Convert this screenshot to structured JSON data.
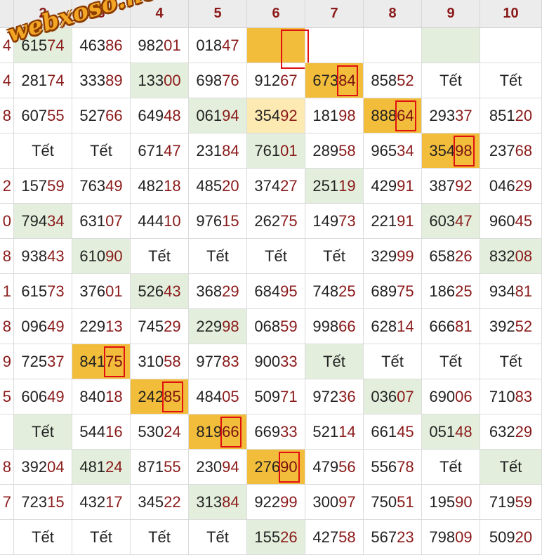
{
  "table": {
    "column_headers": [
      "2",
      "3",
      "4",
      "5",
      "6",
      "7",
      "8",
      "9",
      "10"
    ],
    "left_edge_digits": [
      "4",
      "4",
      "8",
      "",
      "2",
      "0",
      "8",
      "1",
      "8",
      "9",
      "5",
      "",
      "8",
      "7",
      ""
    ],
    "rows": [
      [
        {
          "v": "61574",
          "h": "g"
        },
        {
          "v": "46386"
        },
        {
          "v": "98201"
        },
        {
          "v": "01847"
        },
        {
          "v": "",
          "h": "o",
          "m": 1
        },
        {
          "v": ""
        },
        {
          "v": ""
        },
        {
          "v": "",
          "h": "g"
        },
        {
          "v": ""
        }
      ],
      [
        {
          "v": "28174"
        },
        {
          "v": "33389"
        },
        {
          "v": "13300",
          "h": "g"
        },
        {
          "v": "69876"
        },
        {
          "v": "91267"
        },
        {
          "v": "67384",
          "h": "o",
          "m": 1
        },
        {
          "v": "85852"
        },
        {
          "v": "Tết"
        },
        {
          "v": "Tết"
        }
      ],
      [
        {
          "v": "60755"
        },
        {
          "v": "52766"
        },
        {
          "v": "64948"
        },
        {
          "v": "06194",
          "h": "g"
        },
        {
          "v": "35492",
          "h": "l"
        },
        {
          "v": "18198"
        },
        {
          "v": "88864",
          "h": "o",
          "m": 1
        },
        {
          "v": "29337"
        },
        {
          "v": "85120"
        }
      ],
      [
        {
          "v": "Tết"
        },
        {
          "v": "Tết"
        },
        {
          "v": "67147"
        },
        {
          "v": "23184"
        },
        {
          "v": "76101",
          "h": "g"
        },
        {
          "v": "28958"
        },
        {
          "v": "96534"
        },
        {
          "v": "35498",
          "h": "o",
          "m": 1
        },
        {
          "v": "23768"
        }
      ],
      [
        {
          "v": "15759"
        },
        {
          "v": "76349"
        },
        {
          "v": "48218"
        },
        {
          "v": "48520"
        },
        {
          "v": "37427"
        },
        {
          "v": "25119",
          "h": "g"
        },
        {
          "v": "42991"
        },
        {
          "v": "38792"
        },
        {
          "v": "04629"
        }
      ],
      [
        {
          "v": "79434",
          "h": "g"
        },
        {
          "v": "63107"
        },
        {
          "v": "44410"
        },
        {
          "v": "97615"
        },
        {
          "v": "26275"
        },
        {
          "v": "14973"
        },
        {
          "v": "22191"
        },
        {
          "v": "60347",
          "h": "g"
        },
        {
          "v": "96045"
        }
      ],
      [
        {
          "v": "93843"
        },
        {
          "v": "61090",
          "h": "g"
        },
        {
          "v": "Tết"
        },
        {
          "v": "Tết"
        },
        {
          "v": "Tết"
        },
        {
          "v": "Tết"
        },
        {
          "v": "32999"
        },
        {
          "v": "65826"
        },
        {
          "v": "83208",
          "h": "g"
        }
      ],
      [
        {
          "v": "61573"
        },
        {
          "v": "37601"
        },
        {
          "v": "52643",
          "h": "g"
        },
        {
          "v": "36829"
        },
        {
          "v": "68495"
        },
        {
          "v": "74825"
        },
        {
          "v": "68975"
        },
        {
          "v": "18625"
        },
        {
          "v": "93481"
        }
      ],
      [
        {
          "v": "09649"
        },
        {
          "v": "22913"
        },
        {
          "v": "74529"
        },
        {
          "v": "22998",
          "h": "g"
        },
        {
          "v": "06859"
        },
        {
          "v": "99866"
        },
        {
          "v": "62814"
        },
        {
          "v": "66681"
        },
        {
          "v": "39252"
        }
      ],
      [
        {
          "v": "72537"
        },
        {
          "v": "84175",
          "h": "o",
          "m": 1
        },
        {
          "v": "31058"
        },
        {
          "v": "97783"
        },
        {
          "v": "90033"
        },
        {
          "v": "Tết",
          "h": "g"
        },
        {
          "v": "Tết"
        },
        {
          "v": "Tết"
        },
        {
          "v": "Tết"
        }
      ],
      [
        {
          "v": "60649"
        },
        {
          "v": "84018"
        },
        {
          "v": "24285",
          "h": "o",
          "m": 1
        },
        {
          "v": "48405"
        },
        {
          "v": "50971"
        },
        {
          "v": "97236"
        },
        {
          "v": "03607",
          "h": "g"
        },
        {
          "v": "69006"
        },
        {
          "v": "71083"
        }
      ],
      [
        {
          "v": "Tết",
          "h": "g"
        },
        {
          "v": "54416"
        },
        {
          "v": "53024"
        },
        {
          "v": "81966",
          "h": "o",
          "m": 1
        },
        {
          "v": "66933"
        },
        {
          "v": "52114"
        },
        {
          "v": "66145"
        },
        {
          "v": "05148",
          "h": "g"
        },
        {
          "v": "63229"
        }
      ],
      [
        {
          "v": "39204"
        },
        {
          "v": "48124",
          "h": "g"
        },
        {
          "v": "87155"
        },
        {
          "v": "23094"
        },
        {
          "v": "27690",
          "h": "o",
          "m": 1
        },
        {
          "v": "47956"
        },
        {
          "v": "55678"
        },
        {
          "v": "Tết"
        },
        {
          "v": "Tết",
          "h": "g"
        }
      ],
      [
        {
          "v": "72315"
        },
        {
          "v": "43217"
        },
        {
          "v": "34522"
        },
        {
          "v": "31384",
          "h": "g"
        },
        {
          "v": "92299"
        },
        {
          "v": "30097"
        },
        {
          "v": "75051"
        },
        {
          "v": "19590"
        },
        {
          "v": "71959"
        }
      ],
      [
        {
          "v": "Tết"
        },
        {
          "v": "Tết"
        },
        {
          "v": "Tết"
        },
        {
          "v": "Tết"
        },
        {
          "v": "15526",
          "h": "g"
        },
        {
          "v": "42758"
        },
        {
          "v": "56723"
        },
        {
          "v": "79809"
        },
        {
          "v": "50920"
        }
      ]
    ]
  },
  "watermark": "webxoso.net",
  "colors": {
    "header_bg": "#ececec",
    "header_text": "#8b1a1a",
    "green": "#e3efdc",
    "orange": "#f2bd3b",
    "light": "#fde9b2",
    "mark": "#e01010",
    "tail": "#8b1a1a"
  }
}
